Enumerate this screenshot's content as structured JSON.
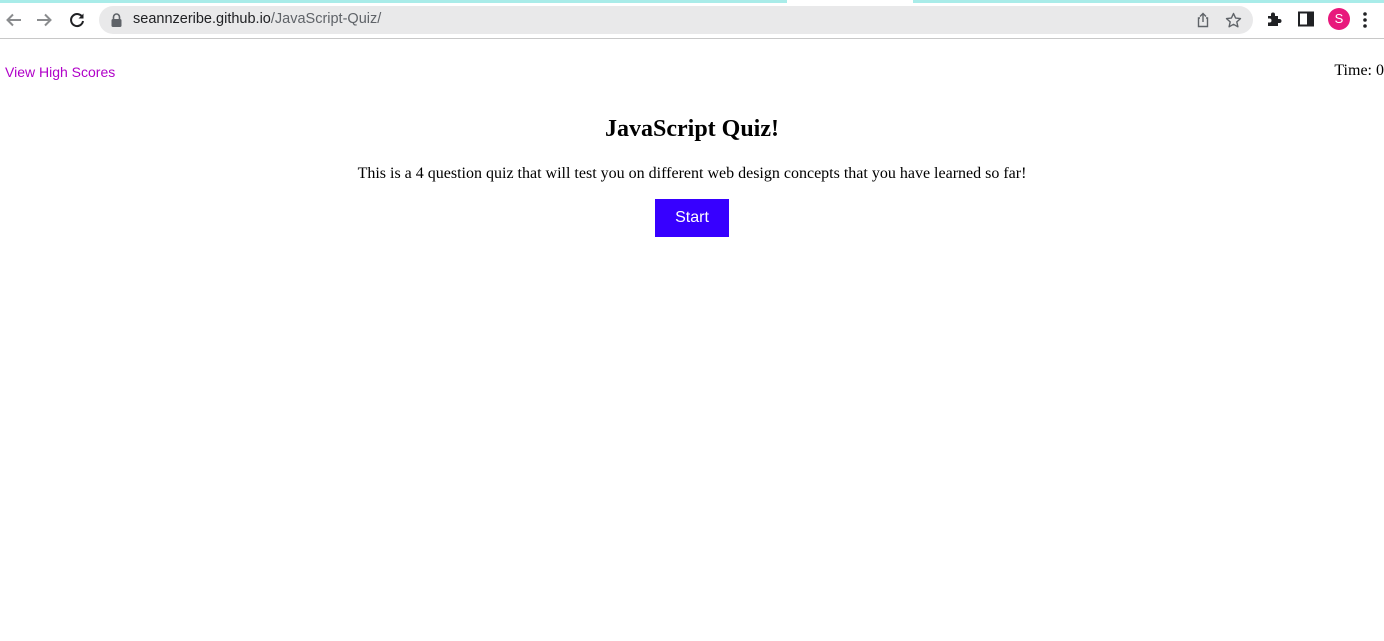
{
  "browser": {
    "url_host": "seannzeribe.github.io",
    "url_path": "/JavaScript-Quiz/",
    "profile_initial": "S",
    "accent_color": "#a9ece9",
    "avatar_color": "#e8187c",
    "icons": [
      "back-arrow-icon",
      "forward-arrow-icon",
      "reload-icon",
      "lock-icon",
      "share-icon",
      "star-icon",
      "extensions-icon",
      "side-panel-icon",
      "kebab-menu-icon"
    ]
  },
  "page": {
    "high_scores_link": "View High Scores",
    "timer_label": "Time: ",
    "timer_value": "0",
    "title": "JavaScript Quiz!",
    "intro": "This is a 4 question quiz that will test you on different web design concepts that you have learned so far!",
    "start_label": "Start",
    "link_color": "#b000c8",
    "button_color": "#3700ff"
  }
}
